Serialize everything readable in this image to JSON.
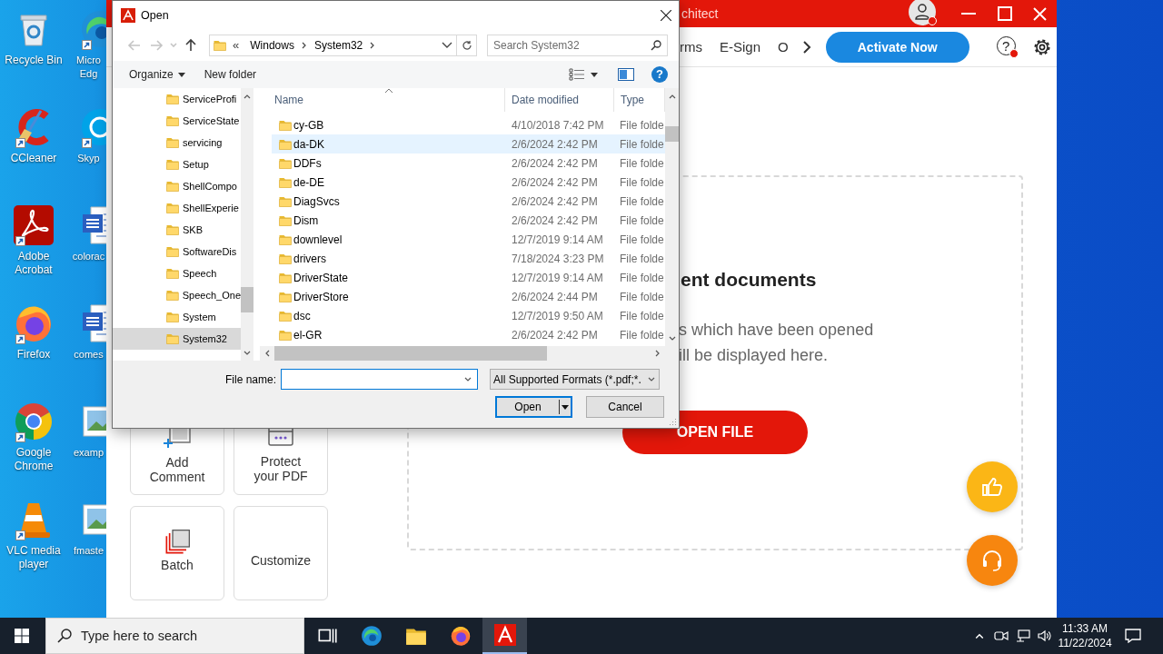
{
  "desktop": {
    "columns": [
      [
        {
          "label": "Recycle Bin",
          "kind": "recycle",
          "shortcut": false
        },
        {
          "label": "CCleaner",
          "kind": "ccleaner",
          "shortcut": true
        },
        {
          "label": "Adobe Acrobat",
          "kind": "acrobat",
          "shortcut": true
        },
        {
          "label": "Firefox",
          "kind": "firefox",
          "shortcut": true
        },
        {
          "label": "Google Chrome",
          "kind": "chrome",
          "shortcut": true
        },
        {
          "label": "VLC media player",
          "kind": "vlc",
          "shortcut": true
        }
      ],
      [
        {
          "label": "Micro Edg",
          "kind": "edge",
          "shortcut": true
        },
        {
          "label": "Skyp",
          "kind": "skype",
          "shortcut": true
        },
        {
          "label": "colorac",
          "kind": "word",
          "shortcut": false
        },
        {
          "label": "comes",
          "kind": "word",
          "shortcut": false
        },
        {
          "label": "examp",
          "kind": "image",
          "shortcut": false
        },
        {
          "label": "fmaste",
          "kind": "image",
          "shortcut": false
        }
      ]
    ]
  },
  "app": {
    "title": "chitect",
    "menu": [
      "rms",
      "E-Sign",
      "O"
    ],
    "activate": "Activate Now",
    "help": "?",
    "tools": [
      {
        "label": "Add Comment",
        "kind": "comment"
      },
      {
        "label": "Protect your PDF",
        "kind": "protect"
      },
      {
        "label": "Batch",
        "kind": "batch"
      },
      {
        "label": "Customize",
        "kind": "none"
      }
    ],
    "recent": {
      "heading": "ent documents",
      "lines": [
        "s which have been opened",
        "ill be displayed here."
      ],
      "button": "OPEN FILE"
    }
  },
  "dialog": {
    "title": "Open",
    "nav": [
      {
        "kind": "back",
        "disabled": true
      },
      {
        "kind": "forward",
        "disabled": true
      },
      {
        "kind": "recent",
        "disabled": true
      },
      {
        "kind": "up",
        "disabled": false
      }
    ],
    "address": {
      "overflow": "«",
      "crumbs": [
        "Windows",
        "System32"
      ]
    },
    "search_placeholder": "Search System32",
    "toolbar": {
      "organize": "Organize",
      "new_folder": "New folder",
      "help": "?"
    },
    "tree": [
      {
        "label": "ServiceProfi",
        "selected": false
      },
      {
        "label": "ServiceState",
        "selected": false
      },
      {
        "label": "servicing",
        "selected": false
      },
      {
        "label": "Setup",
        "selected": false
      },
      {
        "label": "ShellCompo",
        "selected": false
      },
      {
        "label": "ShellExperie",
        "selected": false
      },
      {
        "label": "SKB",
        "selected": false
      },
      {
        "label": "SoftwareDis",
        "selected": false
      },
      {
        "label": "Speech",
        "selected": false
      },
      {
        "label": "Speech_One",
        "selected": false
      },
      {
        "label": "System",
        "selected": false
      },
      {
        "label": "System32",
        "selected": true
      }
    ],
    "columns": [
      "Name",
      "Date modified",
      "Type"
    ],
    "files": [
      {
        "name": "cy-GB",
        "date": "4/10/2018 7:42 PM",
        "type": "File folde",
        "selected": false
      },
      {
        "name": "da-DK",
        "date": "2/6/2024 2:42 PM",
        "type": "File folde",
        "selected": true
      },
      {
        "name": "DDFs",
        "date": "2/6/2024 2:42 PM",
        "type": "File folde",
        "selected": false
      },
      {
        "name": "de-DE",
        "date": "2/6/2024 2:42 PM",
        "type": "File folde",
        "selected": false
      },
      {
        "name": "DiagSvcs",
        "date": "2/6/2024 2:42 PM",
        "type": "File folde",
        "selected": false
      },
      {
        "name": "Dism",
        "date": "2/6/2024 2:42 PM",
        "type": "File folde",
        "selected": false
      },
      {
        "name": "downlevel",
        "date": "12/7/2019 9:14 AM",
        "type": "File folde",
        "selected": false
      },
      {
        "name": "drivers",
        "date": "7/18/2024 3:23 PM",
        "type": "File folde",
        "selected": false
      },
      {
        "name": "DriverState",
        "date": "12/7/2019 9:14 AM",
        "type": "File folde",
        "selected": false
      },
      {
        "name": "DriverStore",
        "date": "2/6/2024 2:44 PM",
        "type": "File folde",
        "selected": false
      },
      {
        "name": "dsc",
        "date": "12/7/2019 9:50 AM",
        "type": "File folde",
        "selected": false
      },
      {
        "name": "el-GR",
        "date": "2/6/2024 2:42 PM",
        "type": "File folde",
        "selected": false
      }
    ],
    "file_name_label": "File name:",
    "file_type": "All Supported Formats (*.pdf;*.",
    "buttons": [
      "Open",
      "Cancel"
    ]
  },
  "taskbar": {
    "search_placeholder": "Type here to search",
    "apps": [
      {
        "kind": "taskview",
        "active": false
      },
      {
        "kind": "edge",
        "active": false
      },
      {
        "kind": "explorer",
        "active": false
      },
      {
        "kind": "firefox",
        "active": false
      },
      {
        "kind": "acrobat",
        "active": true
      }
    ],
    "time": "11:33 AM",
    "date": "11/22/2024"
  }
}
